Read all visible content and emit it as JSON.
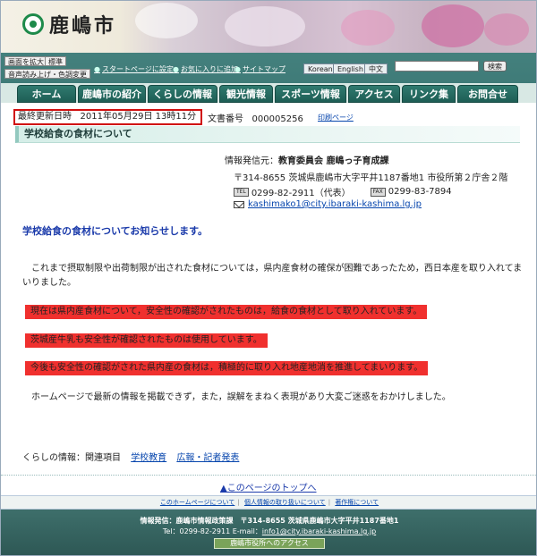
{
  "header": {
    "site_name": "鹿嶋市",
    "util_buttons": [
      "画面を拡大",
      "標準",
      "音声読み上げ・色調変更"
    ],
    "util_links": [
      "スタートページに設定",
      "お気に入りに追加",
      "サイトマップ"
    ],
    "languages": [
      "Korean",
      "English",
      "中文"
    ],
    "search_button": "検索",
    "search_placeholder": ""
  },
  "nav": {
    "items": [
      "ホーム",
      "鹿嶋市の紹介",
      "くらしの情報",
      "観光情報",
      "スポーツ情報",
      "アクセス",
      "リンク集",
      "お問合せ"
    ]
  },
  "meta": {
    "updated_label": "最終更新日時",
    "updated_value": "2011年05月29日 13時11分",
    "doc_label": "文書番号",
    "doc_value": "000005256",
    "print_link": "印刷ページ"
  },
  "page_title": "学校給食の食材について",
  "sender": {
    "label": "情報発信元：",
    "name": "教育委員会 鹿嶋っ子育成課",
    "address": "〒314-8655  茨城県鹿嶋市大字平井1187番地1  市役所第２庁舎２階",
    "tel_tag": "TEL",
    "tel": "0299-82-2911（代表）",
    "fax_tag": "FAX",
    "fax": "0299-83-7894",
    "email": "kashimako1@city.ibaraki-kashima.lg.jp"
  },
  "content": {
    "heading": "学校給食の食材についてお知らせします。",
    "paragraph1": "これまで摂取制限や出荷制限が出された食材については，県内産食材の確保が困難であったため，西日本産を取り入れてまいりました。",
    "highlights": [
      "現在は県内産食材について，安全性の確認がされたものは，給食の食材として取り入れています。",
      "茨城産牛乳も安全性が確認されたものは使用しています。",
      "今後も安全性の確認がされた県内産の食材は，積極的に取り入れ地産地消を推進してまいります。"
    ],
    "paragraph2": "ホームページで最新の情報を掲載できず，また，誤解をまねく表現があり大変ご迷惑をおかけしました。"
  },
  "related": {
    "label": "くらしの情報：関連項目",
    "links": [
      "学校教育",
      "広報・記者発表"
    ]
  },
  "footer": {
    "page_top": "▲このページのトップへ",
    "links": [
      "このホームページについて",
      "個人情報の取り扱いについて",
      "著作権について"
    ],
    "line1": "情報発信：鹿嶋市情報政策課　〒314-8655 茨城県鹿嶋市大字平井1187番地1",
    "tel_text": "Tel：0299-82-2911 E-mail：",
    "email": "info1@city.ibaraki-kashima.lg.jp",
    "access_button": "鹿嶋市役所へのアクセス"
  },
  "colors": {
    "header_teal": "#3f7b78",
    "nav_green": "#2f7a6f",
    "highlight_red": "#f0302e",
    "heading_blue": "#1a3aaa",
    "link_blue": "#0645ad"
  }
}
